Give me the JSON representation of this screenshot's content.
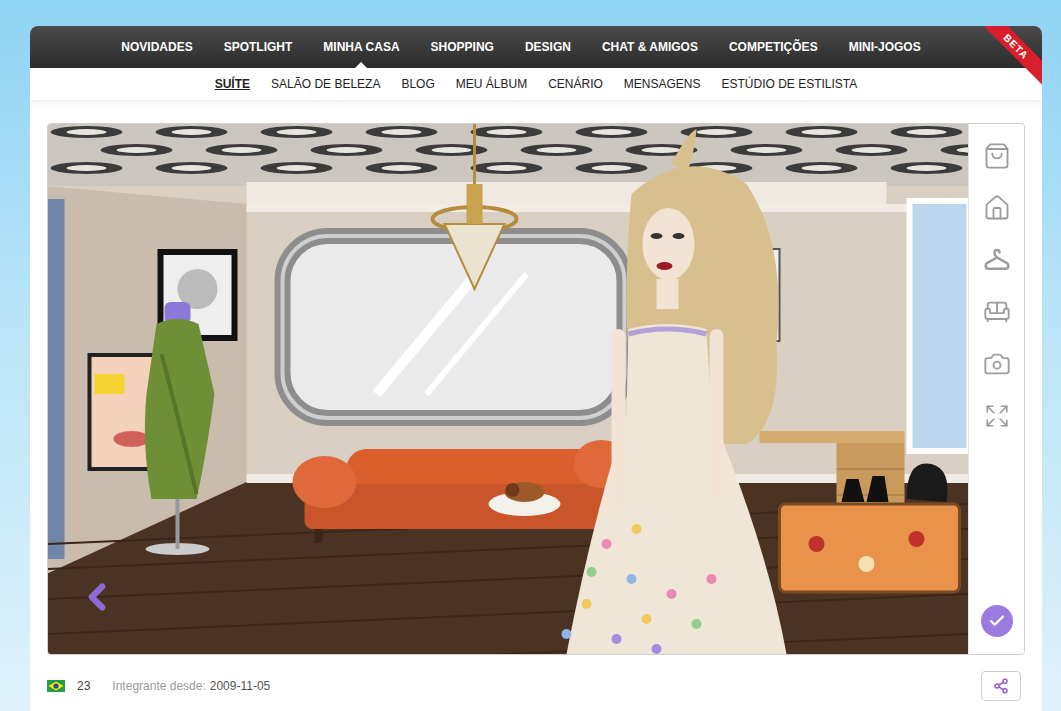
{
  "nav": {
    "items": [
      {
        "label": "NOVIDADES",
        "selected": false
      },
      {
        "label": "SPOTLIGHT",
        "selected": false
      },
      {
        "label": "MINHA CASA",
        "selected": true
      },
      {
        "label": "SHOPPING",
        "selected": false
      },
      {
        "label": "DESIGN",
        "selected": false
      },
      {
        "label": "CHAT & AMIGOS",
        "selected": false
      },
      {
        "label": "COMPETIÇÕES",
        "selected": false
      },
      {
        "label": "MINI-JOGOS",
        "selected": false
      }
    ],
    "badge": "BETA"
  },
  "subnav": {
    "items": [
      {
        "label": "SUÍTE",
        "selected": true
      },
      {
        "label": "SALÃO DE BELEZA",
        "selected": false
      },
      {
        "label": "BLOG",
        "selected": false
      },
      {
        "label": "MEU ÁLBUM",
        "selected": false
      },
      {
        "label": "CENÁRIO",
        "selected": false
      },
      {
        "label": "MENSAGENS",
        "selected": false
      },
      {
        "label": "ESTÚDIO DE ESTILISTA",
        "selected": false
      }
    ]
  },
  "profile": {
    "age": "23",
    "member_label": "Integrante desde:",
    "member_since": "2009-11-05"
  }
}
